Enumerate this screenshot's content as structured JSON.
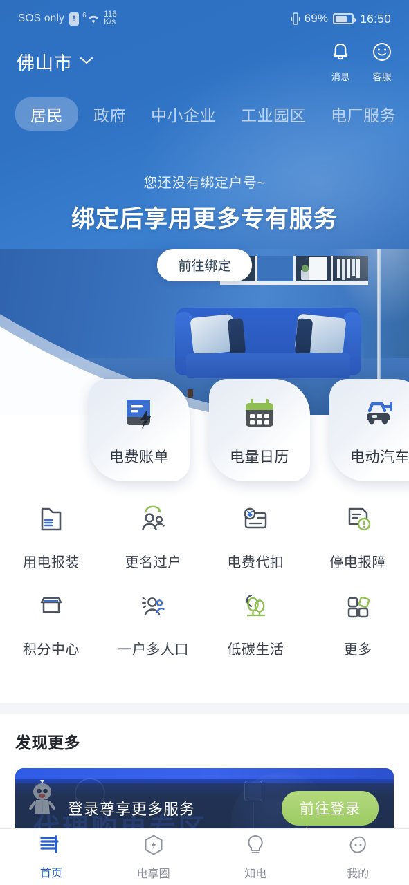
{
  "status_bar": {
    "carrier": "SOS only",
    "network_gen": "6",
    "speed_value": "116",
    "speed_unit": "K/s",
    "battery_percent": "69%",
    "battery_level": 69,
    "time": "16:50",
    "icons": [
      "signal-warning-icon",
      "wifi-icon",
      "vibrate-icon",
      "battery-icon"
    ]
  },
  "header": {
    "city": "佛山市",
    "chevron_icon": "chevron-down-icon",
    "actions": [
      {
        "label": "消息",
        "icon": "bell-icon"
      },
      {
        "label": "客服",
        "icon": "customer-service-icon"
      }
    ]
  },
  "tabs": {
    "active_index": 0,
    "items": [
      {
        "label": "居民"
      },
      {
        "label": "政府"
      },
      {
        "label": "中小企业"
      },
      {
        "label": "工业园区"
      },
      {
        "label": "电厂服务"
      }
    ]
  },
  "hero": {
    "subtitle": "您还没有绑定户号~",
    "title": "绑定后享用更多专有服务",
    "cta_label": "前往绑定"
  },
  "service_cards": [
    {
      "label": "电费账单",
      "icon": "bill-document-icon",
      "color": "#3b6fd4"
    },
    {
      "label": "电量日历",
      "icon": "calendar-icon",
      "color": "#4e5358"
    },
    {
      "label": "电动汽车",
      "icon": "ev-charging-car-icon",
      "color": "#3b6fd4"
    }
  ],
  "quick_grid": {
    "rows": [
      [
        {
          "label": "用电报装",
          "icon": "power-application-icon"
        },
        {
          "label": "更名过户",
          "icon": "transfer-ownership-icon"
        },
        {
          "label": "电费代扣",
          "icon": "auto-payment-card-icon"
        },
        {
          "label": "停电报障",
          "icon": "outage-report-icon"
        }
      ],
      [
        {
          "label": "积分中心",
          "icon": "points-shop-icon"
        },
        {
          "label": "一户多人口",
          "icon": "multi-person-household-icon"
        },
        {
          "label": "低碳生活",
          "icon": "low-carbon-trees-icon"
        },
        {
          "label": "更多",
          "icon": "more-grid-icon"
        }
      ]
    ]
  },
  "discover": {
    "title": "发现更多",
    "banner": {
      "headline": "代理购电专区",
      "login_prompt": "登录尊享更多服务",
      "login_button": "前往登录",
      "mascot_icon": "mascot-icon"
    }
  },
  "bottom_nav": {
    "active_index": 0,
    "items": [
      {
        "label": "首页",
        "icon": "home-grid-icon"
      },
      {
        "label": "电享圈",
        "icon": "hexagon-bolt-icon"
      },
      {
        "label": "知电",
        "icon": "lightbulb-icon"
      },
      {
        "label": "我的",
        "icon": "profile-face-icon"
      }
    ]
  },
  "colors": {
    "brand_blue": "#2a5fd0",
    "hero_blue": "#2f72c4",
    "accent_green": "#9ccb63",
    "banner_navy": "#16264e"
  }
}
